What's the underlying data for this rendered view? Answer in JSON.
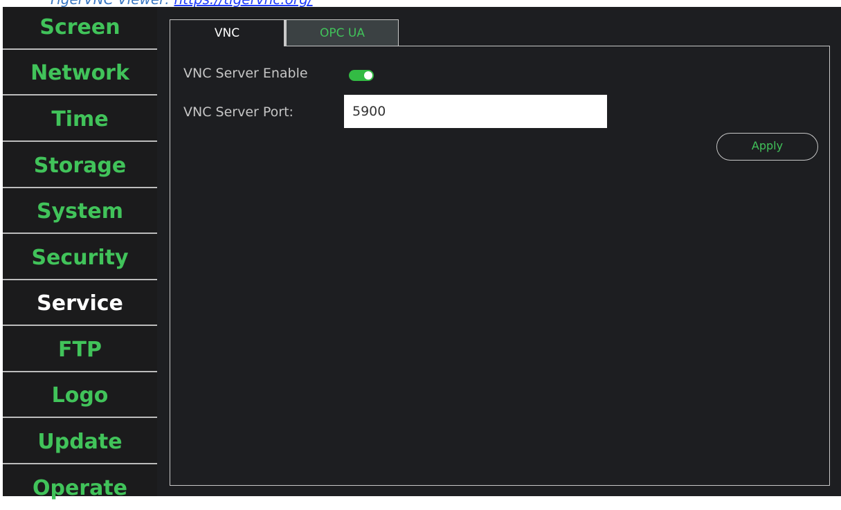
{
  "banner": {
    "prefix": "TigerVNC Viewer: ",
    "link": "https://tigervnc.org/"
  },
  "sidebar": {
    "items": [
      {
        "label": "Screen"
      },
      {
        "label": "Network"
      },
      {
        "label": "Time"
      },
      {
        "label": "Storage"
      },
      {
        "label": "System"
      },
      {
        "label": "Security"
      },
      {
        "label": "Service"
      },
      {
        "label": "FTP"
      },
      {
        "label": "Logo"
      },
      {
        "label": "Update"
      },
      {
        "label": "Operate"
      }
    ],
    "active": "Service"
  },
  "tabs": [
    {
      "label": "VNC"
    },
    {
      "label": "OPC UA"
    }
  ],
  "active_tab": "VNC",
  "vnc": {
    "enable_label": "VNC Server Enable",
    "enabled": true,
    "port_label": "VNC Server Port:",
    "port_value": "5900",
    "apply_label": "Apply"
  },
  "colors": {
    "accent": "#41c35a",
    "sidebar_bg": "#1b1b1c",
    "main_bg": "#1d1e21",
    "inactive_tab_bg": "#3b4143",
    "toggle_on": "#33bb44",
    "link": "#1f3cff"
  }
}
